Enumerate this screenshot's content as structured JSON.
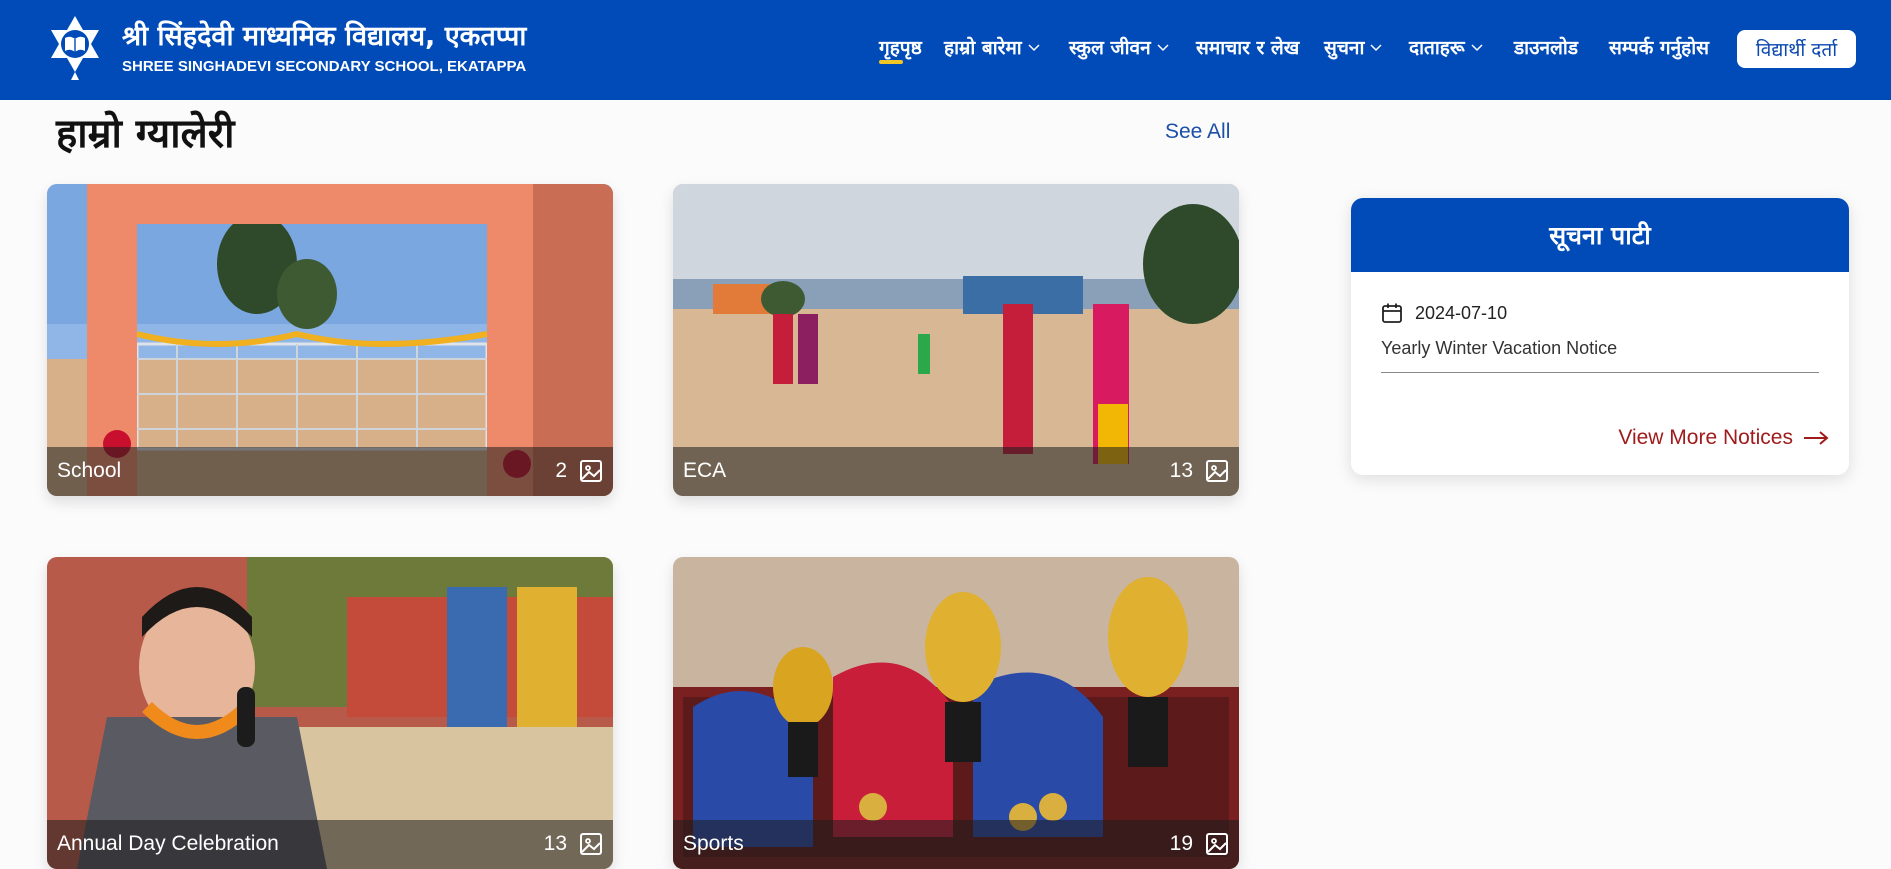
{
  "header": {
    "title_np": "श्री सिंहदेवी माध्यमिक विद्यालय, एकतप्पा",
    "title_en": "SHREE SINGHADEVI SECONDARY SCHOOL, EKATAPPA",
    "logo_icon": "star-book-logo-icon",
    "nav": [
      {
        "label": "गृहपृष्ठ",
        "dropdown": false,
        "active": true
      },
      {
        "label": "हाम्रो बारेमा",
        "dropdown": true
      },
      {
        "label": "स्कुल जीवन",
        "dropdown": true
      },
      {
        "label": "समाचार र लेख",
        "dropdown": false
      },
      {
        "label": "सुचना",
        "dropdown": true
      },
      {
        "label": "दाताहरू",
        "dropdown": true
      },
      {
        "label": "डाउनलोड",
        "dropdown": false
      },
      {
        "label": "सम्पर्क गर्नुहोस",
        "dropdown": false
      }
    ],
    "admission_button": "विद्यार्थी दर्ता"
  },
  "gallery": {
    "title": "हाम्रो ग्यालेरी",
    "see_all": "See All",
    "albums": [
      {
        "name": "School",
        "count": "2"
      },
      {
        "name": "ECA",
        "count": "13"
      },
      {
        "name": "Annual Day Celebration",
        "count": "13"
      },
      {
        "name": "Sports",
        "count": "19"
      }
    ]
  },
  "notice_board": {
    "title": "सूचना पाटी",
    "notices": [
      {
        "date": "2024-07-10",
        "title": "Yearly Winter Vacation Notice"
      }
    ],
    "view_more": "View More Notices"
  },
  "colors": {
    "primary": "#004bb8",
    "accent": "#f3c623",
    "link_red": "#a01c1c"
  }
}
